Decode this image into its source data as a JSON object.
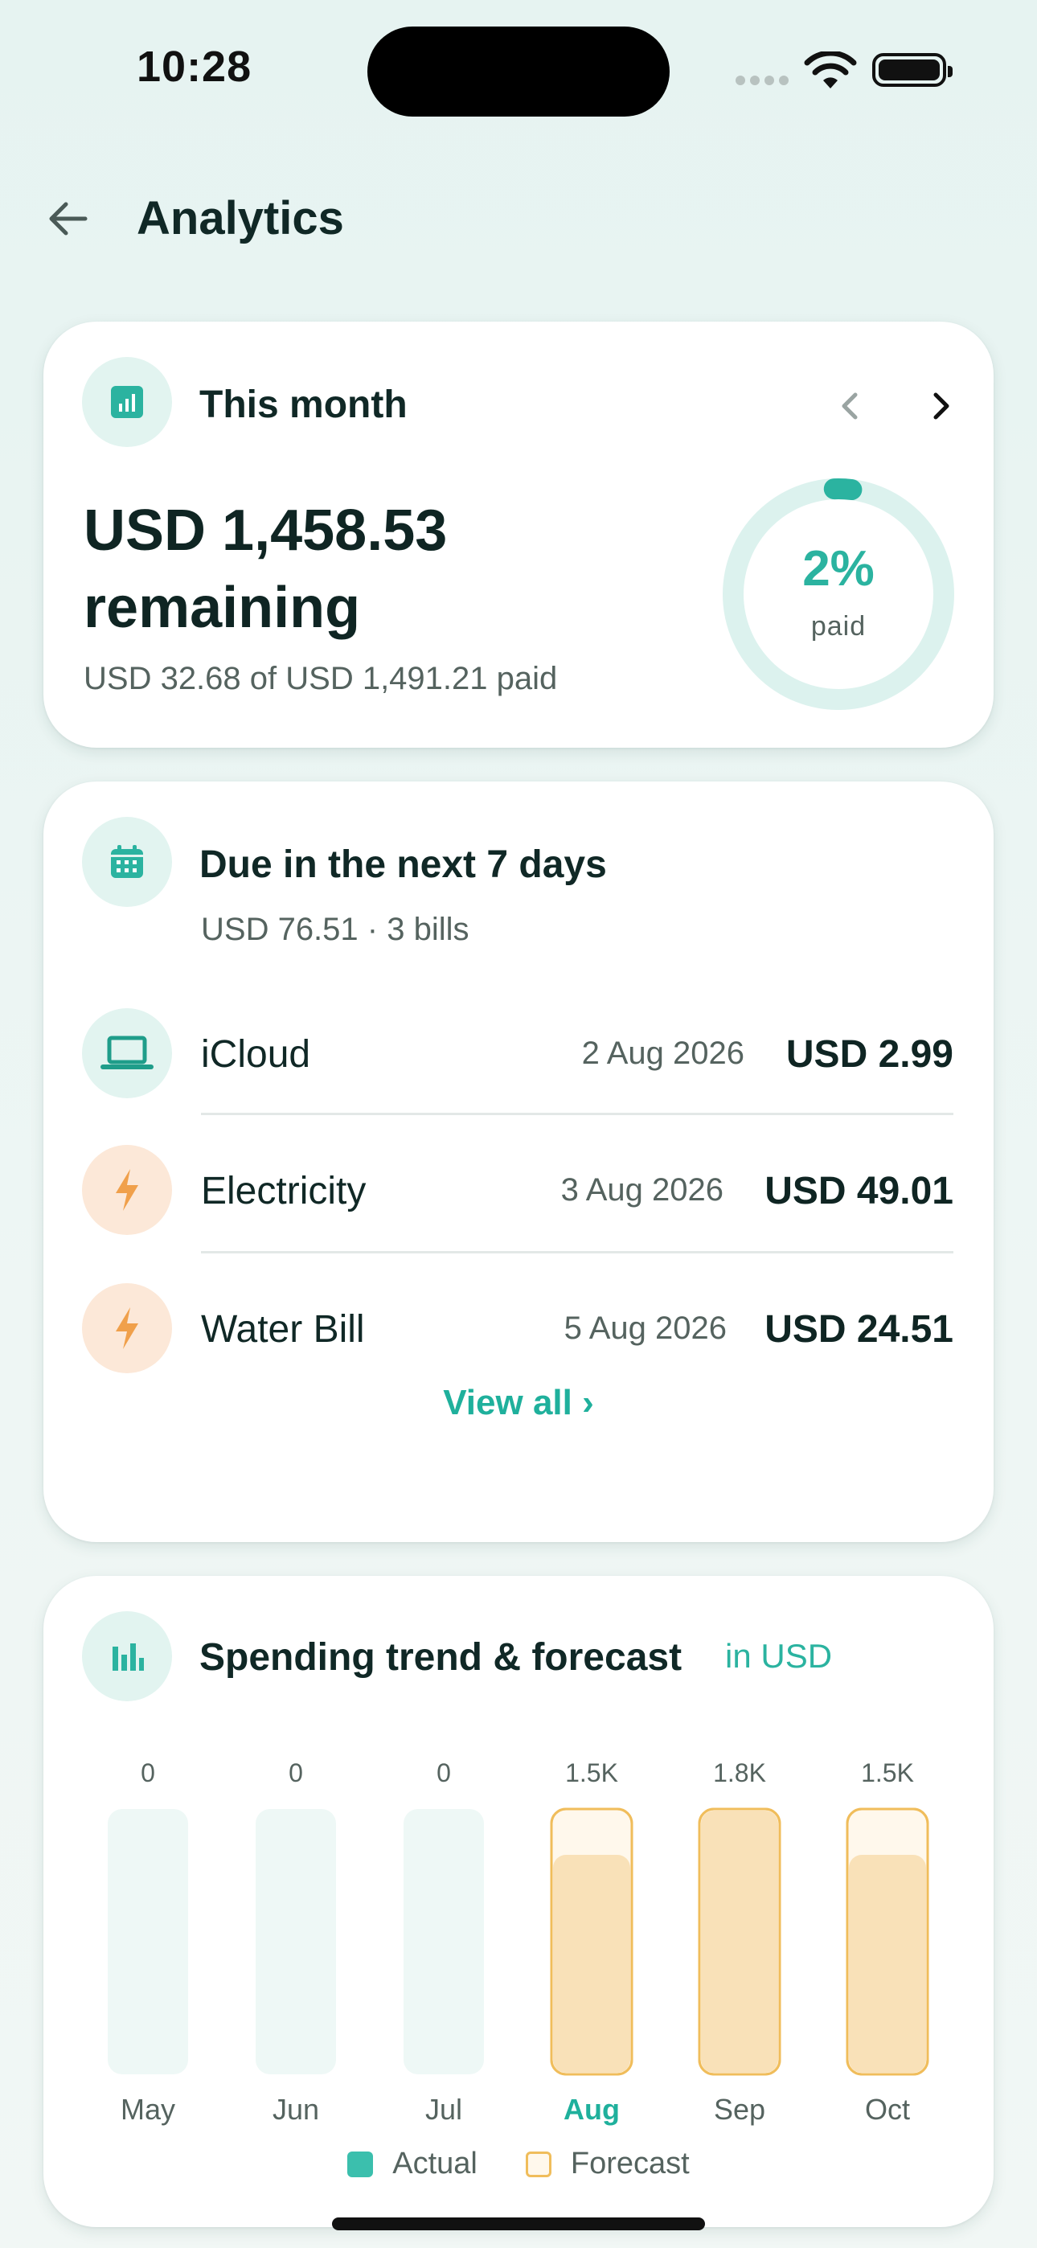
{
  "status_bar": {
    "time": "10:28"
  },
  "header": {
    "title": "Analytics",
    "back_icon": "arrow-left-icon"
  },
  "month_card": {
    "title": "This month",
    "icon": "bar-chart-icon",
    "remaining_line1": "USD 1,458.53",
    "remaining_line2": "remaining",
    "paid_summary": "USD 32.68 of USD 1,491.21 paid",
    "percent_text": "2%",
    "percent_label": "paid",
    "percent_paid": 0.02,
    "accent": "#2bb3a0"
  },
  "due_card": {
    "title": "Due in the next 7 days",
    "icon": "calendar-icon",
    "subtitle": "USD 76.51 · 3 bills",
    "bills": [
      {
        "name": "iCloud",
        "date": "2 Aug 2026",
        "amount": "USD 2.99",
        "icon": "laptop-icon"
      },
      {
        "name": "Electricity",
        "date": "3 Aug 2026",
        "amount": "USD 49.01",
        "icon": "lightning-icon"
      },
      {
        "name": "Water Bill",
        "date": "5 Aug 2026",
        "amount": "USD 24.51",
        "icon": "lightning-icon"
      }
    ],
    "view_all": "View all ›"
  },
  "trend_card": {
    "title": "Spending trend & forecast",
    "unit_label": "in USD",
    "icon": "bar-chart-icon",
    "legend": {
      "actual": "Actual",
      "forecast": "Forecast"
    }
  },
  "chart_data": {
    "type": "bar",
    "categories": [
      "May",
      "Jun",
      "Jul",
      "Aug",
      "Sep",
      "Oct"
    ],
    "value_labels": [
      "0",
      "0",
      "0",
      "1.5K",
      "1.8K",
      "1.5K"
    ],
    "series": [
      {
        "name": "Actual",
        "values": [
          0,
          0,
          0,
          0,
          0,
          0
        ]
      },
      {
        "name": "Forecast",
        "values": [
          0,
          0,
          0,
          1500,
          1800,
          1500
        ]
      }
    ],
    "highlighted_category": "Aug",
    "colors": {
      "actual": "#3bbfad",
      "forecast_fill": "#f9e1b8",
      "forecast_outline": "#f0bd5b",
      "empty_bar": "#eef8f6"
    }
  }
}
